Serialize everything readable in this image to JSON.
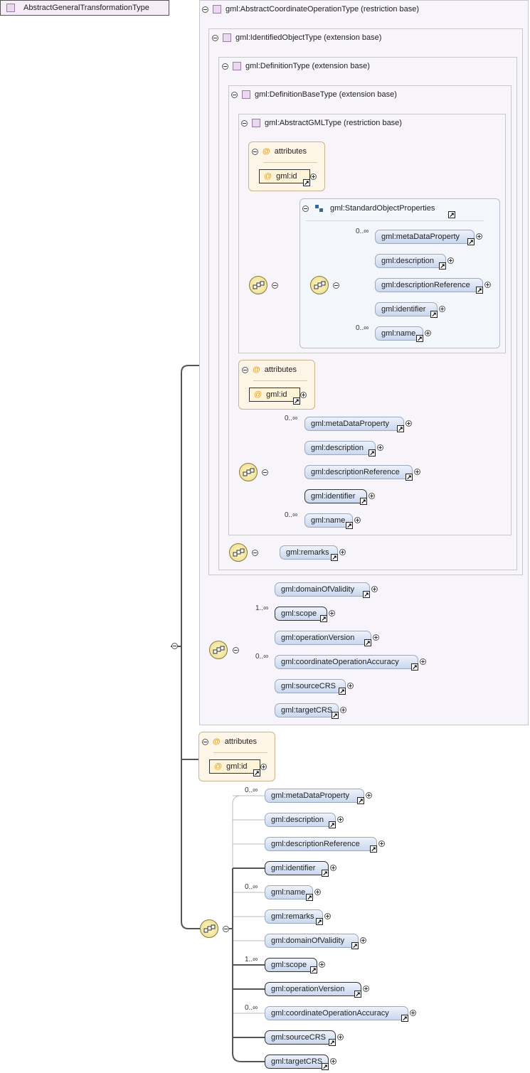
{
  "root": {
    "label": "AbstractGeneralTransformationType"
  },
  "boxes": {
    "coord_op": "gml:AbstractCoordinateOperationType (restriction base)",
    "identified": "gml:IdentifiedObjectType (extension base)",
    "definition": "gml:DefinitionType (extension base)",
    "definition_base": "gml:DefinitionBaseType (extension base)",
    "abstract_gml": "gml:AbstractGMLType (restriction base)",
    "std_props": "gml:StandardObjectProperties"
  },
  "attributes_label": "attributes",
  "attr_id": "gml:id",
  "occurrence": {
    "zero_many": "0..∞",
    "one_many": "1..∞"
  },
  "std_elements": [
    "gml:metaDataProperty",
    "gml:description",
    "gml:descriptionReference",
    "gml:identifier",
    "gml:name"
  ],
  "defbase_elements": [
    "gml:metaDataProperty",
    "gml:description",
    "gml:descriptionReference",
    "gml:identifier",
    "gml:name"
  ],
  "definition_elements": [
    "gml:remarks"
  ],
  "coord_elements": [
    "gml:domainOfValidity",
    "gml:scope",
    "gml:operationVersion",
    "gml:coordinateOperationAccuracy",
    "gml:sourceCRS",
    "gml:targetCRS"
  ],
  "bottom_elements": [
    "gml:metaDataProperty",
    "gml:description",
    "gml:descriptionReference",
    "gml:identifier",
    "gml:name",
    "gml:remarks",
    "gml:domainOfValidity",
    "gml:scope",
    "gml:operationVersion",
    "gml:coordinateOperationAccuracy",
    "gml:sourceCRS",
    "gml:targetCRS"
  ],
  "icons": {
    "collapse": "minus-circle-icon",
    "expand": "plus-circle-icon",
    "link": "arrow-link-icon",
    "sequence": "sequence-icon",
    "type": "complex-type-icon",
    "group": "group-icon"
  }
}
